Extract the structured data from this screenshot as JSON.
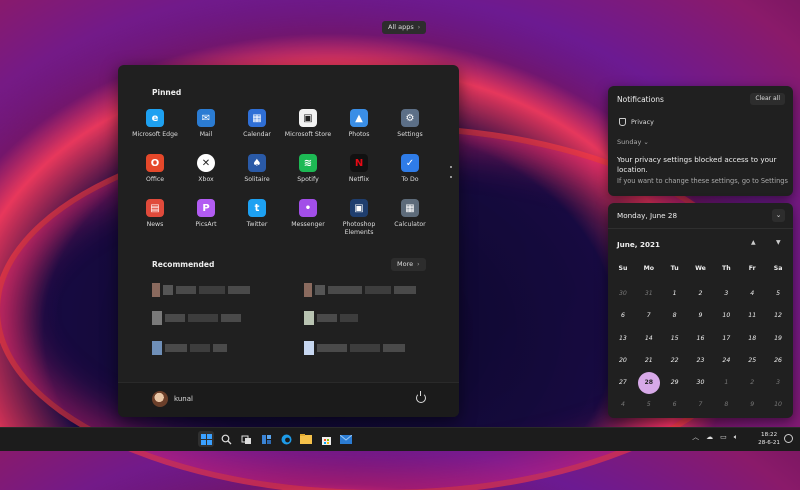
{
  "start_menu": {
    "pinned_title": "Pinned",
    "all_apps_label": "All apps",
    "pinned": [
      {
        "label": "Microsoft Edge",
        "icon": "edge-icon",
        "color": "#1ea1f1",
        "glyph": "e"
      },
      {
        "label": "Mail",
        "icon": "mail-icon",
        "color": "#2b7cd3",
        "glyph": "✉"
      },
      {
        "label": "Calendar",
        "icon": "calendar-icon",
        "color": "#2f6fd6",
        "glyph": "▦"
      },
      {
        "label": "Microsoft Store",
        "icon": "store-icon",
        "color": "#f2f2f2",
        "glyph": "▣"
      },
      {
        "label": "Photos",
        "icon": "photos-icon",
        "color": "#3a8ee6",
        "glyph": "▲"
      },
      {
        "label": "Settings",
        "icon": "settings-icon",
        "color": "#5c6f87",
        "glyph": "⚙"
      },
      {
        "label": "Office",
        "icon": "office-icon",
        "color": "#e5482a",
        "glyph": "O"
      },
      {
        "label": "Xbox",
        "icon": "xbox-icon",
        "color": "#ffffff",
        "glyph": "✕"
      },
      {
        "label": "Solitaire",
        "icon": "solitaire-icon",
        "color": "#2a5aa7",
        "glyph": "♠"
      },
      {
        "label": "Spotify",
        "icon": "spotify-icon",
        "color": "#1db954",
        "glyph": "≋"
      },
      {
        "label": "Netflix",
        "icon": "netflix-icon",
        "color": "#111111",
        "glyph": "N"
      },
      {
        "label": "To Do",
        "icon": "todo-icon",
        "color": "#2f7ce8",
        "glyph": "✓"
      },
      {
        "label": "News",
        "icon": "news-icon",
        "color": "#e04a3b",
        "glyph": "▤"
      },
      {
        "label": "PicsArt",
        "icon": "picsart-icon",
        "color": "#b25cf2",
        "glyph": "P"
      },
      {
        "label": "Twitter",
        "icon": "twitter-icon",
        "color": "#1da1f2",
        "glyph": "t"
      },
      {
        "label": "Messenger",
        "icon": "messenger-icon",
        "color": "#a24ee8",
        "glyph": "•"
      },
      {
        "label": "Photoshop Elements",
        "icon": "photoshop-elements-icon",
        "color": "#1f3e6e",
        "glyph": "▣"
      },
      {
        "label": "Calculator",
        "icon": "calculator-icon",
        "color": "#5d6b7a",
        "glyph": "▦"
      }
    ],
    "recommended_title": "Recommended",
    "more_label": "More",
    "user_name": "kunal"
  },
  "notifications": {
    "title": "Notifications",
    "clear_label": "Clear all",
    "app_name": "Privacy",
    "day": "Sunday",
    "message": "Your privacy settings blocked access to your location.",
    "submessage": "If you want to change these settings, go to Settings"
  },
  "calendar": {
    "header": "Monday, June 28",
    "month": "June, 2021",
    "weekdays": [
      "Su",
      "Mo",
      "Tu",
      "We",
      "Th",
      "Fr",
      "Sa"
    ],
    "days": [
      {
        "d": "30",
        "muted": true
      },
      {
        "d": "31",
        "muted": true
      },
      {
        "d": "1"
      },
      {
        "d": "2"
      },
      {
        "d": "3"
      },
      {
        "d": "4"
      },
      {
        "d": "5"
      },
      {
        "d": "6"
      },
      {
        "d": "7"
      },
      {
        "d": "8"
      },
      {
        "d": "9"
      },
      {
        "d": "10"
      },
      {
        "d": "11"
      },
      {
        "d": "12"
      },
      {
        "d": "13"
      },
      {
        "d": "14"
      },
      {
        "d": "15"
      },
      {
        "d": "16"
      },
      {
        "d": "17"
      },
      {
        "d": "18"
      },
      {
        "d": "19"
      },
      {
        "d": "20"
      },
      {
        "d": "21"
      },
      {
        "d": "22"
      },
      {
        "d": "23"
      },
      {
        "d": "24"
      },
      {
        "d": "25"
      },
      {
        "d": "26"
      },
      {
        "d": "27"
      },
      {
        "d": "28",
        "today": true
      },
      {
        "d": "29"
      },
      {
        "d": "30"
      },
      {
        "d": "1",
        "muted": true
      },
      {
        "d": "2",
        "muted": true
      },
      {
        "d": "3",
        "muted": true
      },
      {
        "d": "4",
        "muted": true
      },
      {
        "d": "5",
        "muted": true
      },
      {
        "d": "6",
        "muted": true
      },
      {
        "d": "7",
        "muted": true
      },
      {
        "d": "8",
        "muted": true
      },
      {
        "d": "9",
        "muted": true
      },
      {
        "d": "10",
        "muted": true
      }
    ]
  },
  "taskbar": {
    "time": "18:22",
    "date": "28-6-21"
  }
}
